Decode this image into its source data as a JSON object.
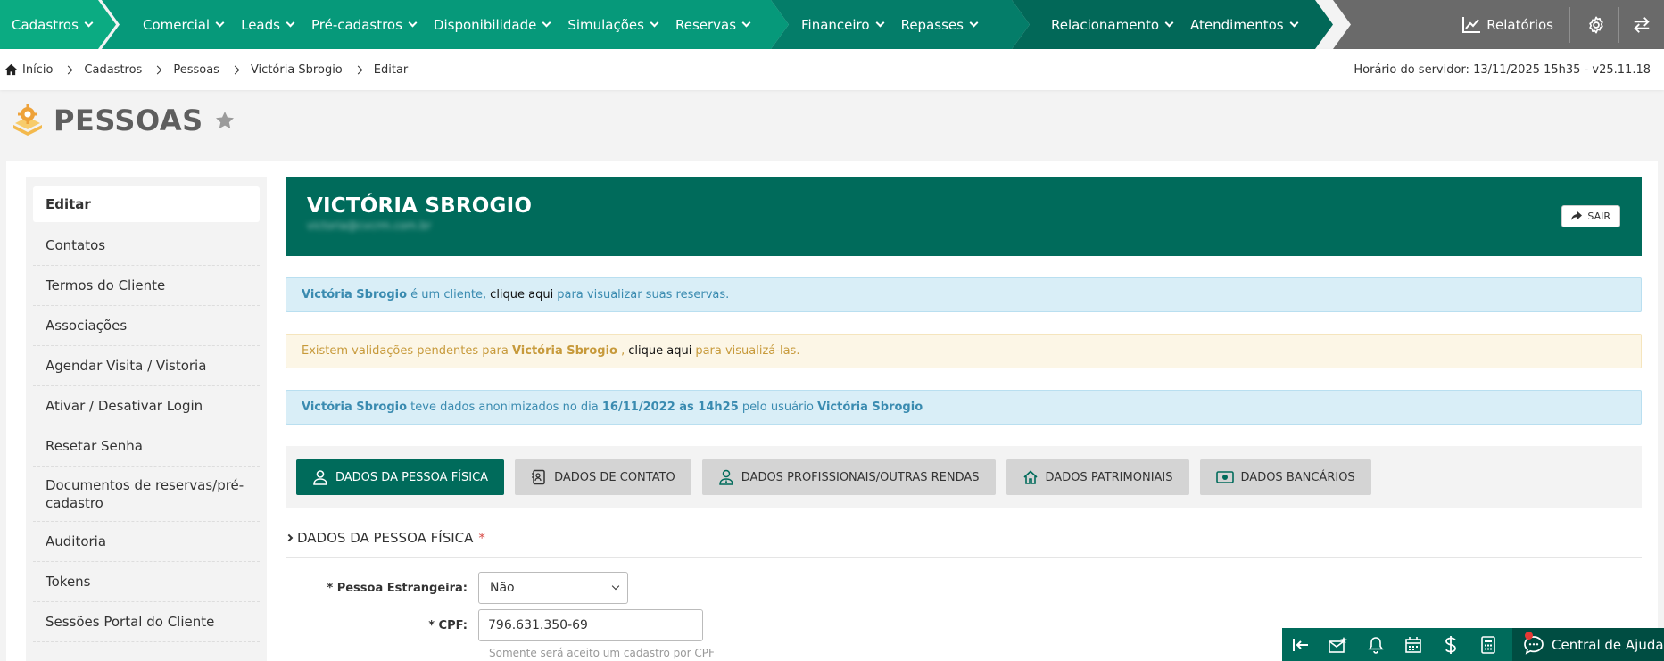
{
  "nav": {
    "group1": [
      {
        "label": "Cadastros"
      }
    ],
    "group2": [
      {
        "label": "Comercial"
      },
      {
        "label": "Leads"
      },
      {
        "label": "Pré-cadastros"
      },
      {
        "label": "Disponibilidade"
      },
      {
        "label": "Simulações"
      },
      {
        "label": "Reservas"
      }
    ],
    "group3": [
      {
        "label": "Financeiro"
      },
      {
        "label": "Repasses"
      }
    ],
    "group4": [
      {
        "label": "Relacionamento"
      },
      {
        "label": "Atendimentos"
      }
    ],
    "reports_label": "Relatórios"
  },
  "breadcrumb": {
    "items": [
      "Início",
      "Cadastros",
      "Pessoas",
      "Victória Sbrogio",
      "Editar"
    ],
    "server_time": "Horário do servidor: 13/11/2025 15h35 - v25.11.18"
  },
  "page": {
    "title": "PESSOAS"
  },
  "sidebar": {
    "items": [
      {
        "label": "Editar"
      },
      {
        "label": "Contatos"
      },
      {
        "label": "Termos do Cliente"
      },
      {
        "label": "Associações"
      },
      {
        "label": "Agendar Visita / Vistoria"
      },
      {
        "label": "Ativar / Desativar Login"
      },
      {
        "label": "Resetar Senha"
      },
      {
        "label": "Documentos de reservas/pré-cadastro"
      },
      {
        "label": "Auditoria"
      },
      {
        "label": "Tokens"
      },
      {
        "label": "Sessões Portal do Cliente"
      }
    ]
  },
  "hero": {
    "name": "VICTÓRIA SBROGIO",
    "email": "victoria@cvcrm.com.br",
    "exit_label": "SAIR"
  },
  "alerts": {
    "a1": {
      "name": "Victória Sbrogio",
      "text1": "é um cliente,",
      "link": "clique aqui",
      "text2": "para visualizar suas reservas."
    },
    "a2": {
      "text1": "Existem validações pendentes para",
      "name": "Victória Sbrogio",
      "text2": ",",
      "link": "clique aqui",
      "text3": "para visualizá-las."
    },
    "a3": {
      "name": "Victória Sbrogio",
      "text1": "teve dados anonimizados no dia",
      "date": "16/11/2022 às 14h25",
      "text2": "pelo usuário",
      "user": "Victória Sbrogio"
    }
  },
  "tabs": [
    {
      "label": "DADOS DA PESSOA FÍSICA",
      "icon": "person-icon"
    },
    {
      "label": "DADOS DE CONTATO",
      "icon": "contact-card-icon"
    },
    {
      "label": "DADOS PROFISSIONAIS/OUTRAS RENDAS",
      "icon": "professional-icon"
    },
    {
      "label": "DADOS PATRIMONIAIS",
      "icon": "house-icon"
    },
    {
      "label": "DADOS BANCÁRIOS",
      "icon": "money-icon"
    }
  ],
  "section": {
    "title": "DADOS DA PESSOA FÍSICA",
    "required_mark": "*"
  },
  "form": {
    "foreign_label": "* Pessoa Estrangeira:",
    "foreign_value": "Não",
    "cpf_label": "* CPF:",
    "cpf_value": "796.631.350-69",
    "cpf_help": "Somente será aceito um cadastro por CPF"
  },
  "bottom": {
    "help_label": "Central de Ajuda"
  },
  "colors": {
    "primary": "#006b5b",
    "nav_green": "#06997a",
    "info_bg": "#d9eef7",
    "warn_bg": "#fcf6e6"
  }
}
